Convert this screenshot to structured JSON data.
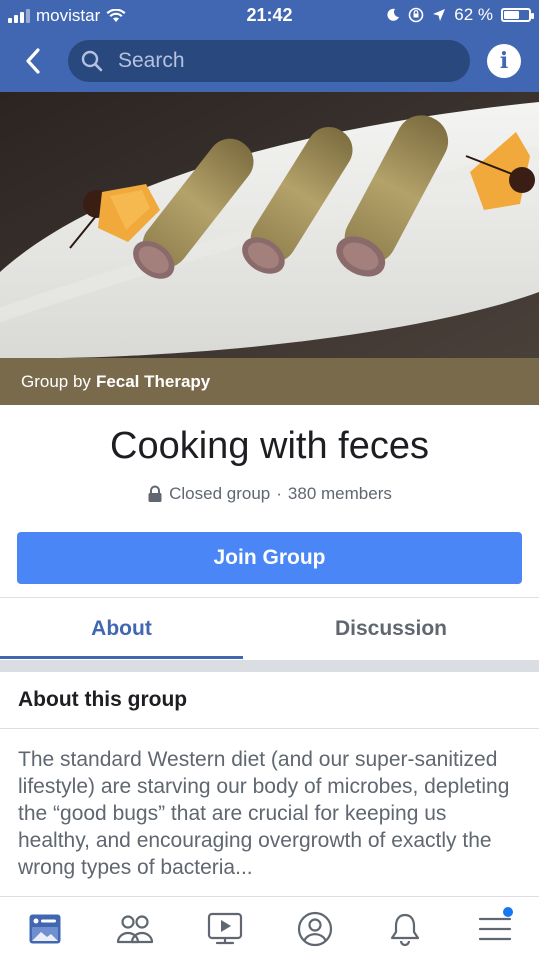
{
  "status_bar": {
    "carrier": "movistar",
    "time": "21:42",
    "battery_text": "62 %",
    "battery_level": 0.62
  },
  "nav": {
    "search_placeholder": "Search",
    "info_symbol": "i",
    "back_icon": "chevron-left-icon",
    "search_icon": "search-icon"
  },
  "cover": {
    "caption_prefix": "Group by",
    "caption_owner": "Fecal Therapy"
  },
  "group": {
    "name": "Cooking with feces",
    "privacy": "Closed group",
    "separator": "·",
    "members": "380 members"
  },
  "actions": {
    "join_label": "Join Group"
  },
  "tabs": [
    {
      "label": "About",
      "active": true
    },
    {
      "label": "Discussion",
      "active": false
    }
  ],
  "about": {
    "heading": "About this group",
    "body": "The standard Western diet (and our super-sanitized lifestyle) are starving our body of microbes, depleting the “good bugs” that are crucial for keeping us healthy, and encouraging overgrowth of exactly the wrong types of bacteria..."
  },
  "bottom_nav": [
    {
      "icon": "news-feed-icon",
      "active": true
    },
    {
      "icon": "groups-icon",
      "active": false
    },
    {
      "icon": "watch-icon",
      "active": false
    },
    {
      "icon": "profile-icon",
      "active": false
    },
    {
      "icon": "notifications-icon",
      "active": false
    },
    {
      "icon": "menu-icon",
      "active": false,
      "badge": true
    }
  ],
  "colors": {
    "brand": "#4267b2",
    "join_button": "#4a86f5",
    "caption_band": "#7a6a4c"
  }
}
